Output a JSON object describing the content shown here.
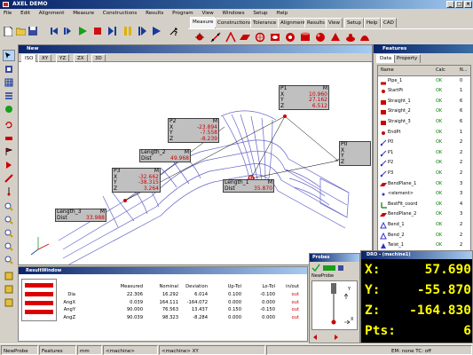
{
  "app": {
    "title": "AXEL DEMO"
  },
  "menu": [
    "File",
    "Edit",
    "Alignment",
    "Measure",
    "Constructions",
    "Results",
    "Program",
    "View",
    "Windows",
    "Setup",
    "Help"
  ],
  "ribbon_tabs": [
    "Measure",
    "Constructions",
    "Tolerance",
    "Alignment",
    "Results",
    "View",
    "Setup",
    "Help",
    "CAD"
  ],
  "ribbon_active": "Measure",
  "view_window": {
    "title": "New",
    "tabs": [
      "ISO",
      "XY",
      "YZ",
      "ZX",
      "3D"
    ],
    "active_tab": "ISO",
    "labels": [
      {
        "name": "P1",
        "flag": "M",
        "rows": [
          [
            "X",
            "10.960"
          ],
          [
            "Y",
            "27.162"
          ],
          [
            "Z",
            "6.512"
          ]
        ]
      },
      {
        "name": "P2",
        "flag": "M",
        "rows": [
          [
            "X",
            "-23.894"
          ],
          [
            "Y",
            "-7.558"
          ],
          [
            "Z",
            "-8.239"
          ]
        ]
      },
      {
        "name": "P3",
        "flag": "M",
        "rows": [
          [
            "X",
            "-32.662"
          ],
          [
            "Y",
            "-38.315"
          ],
          [
            "Z",
            "3.264"
          ]
        ]
      },
      {
        "name": "P0",
        "flag": "",
        "rows": [
          [
            "X",
            ""
          ],
          [
            "Y",
            ""
          ],
          [
            "Z",
            ""
          ]
        ]
      },
      {
        "name": "Length_2",
        "flag": "M",
        "rows": [
          [
            "Dist",
            "49.968"
          ]
        ]
      },
      {
        "name": "Length_1",
        "flag": "M",
        "rows": [
          [
            "Dist",
            "35.870"
          ]
        ]
      },
      {
        "name": "Length_3",
        "flag": "M",
        "rows": [
          [
            "Dist",
            "33.988"
          ]
        ]
      }
    ]
  },
  "features": {
    "title": "Features",
    "tabs": [
      "Data",
      "Property"
    ],
    "active_tab": "Data",
    "columns": [
      "Name",
      "Calc",
      "N..."
    ],
    "rows": [
      {
        "name": "Pipe_1",
        "calc": "OK",
        "n": "0",
        "icon": "pipe-icon",
        "color": "#cc0000"
      },
      {
        "name": "StartPt",
        "calc": "OK",
        "n": "1",
        "icon": "point-icon",
        "color": "#cc0000"
      },
      {
        "name": "Straight_1",
        "calc": "OK",
        "n": "6",
        "icon": "cylinder-icon",
        "color": "#cc0000"
      },
      {
        "name": "Straight_2",
        "calc": "OK",
        "n": "6",
        "icon": "cylinder-icon",
        "color": "#cc0000"
      },
      {
        "name": "Straight_3",
        "calc": "OK",
        "n": "6",
        "icon": "cylinder-icon",
        "color": "#cc0000"
      },
      {
        "name": "EndPt",
        "calc": "OK",
        "n": "1",
        "icon": "point-icon",
        "color": "#cc0000"
      },
      {
        "name": "P0",
        "calc": "OK",
        "n": "2",
        "icon": "point-vector-icon",
        "color": "#3333cc"
      },
      {
        "name": "P1",
        "calc": "OK",
        "n": "2",
        "icon": "point-vector-icon",
        "color": "#3333cc"
      },
      {
        "name": "P2",
        "calc": "OK",
        "n": "2",
        "icon": "point-vector-icon",
        "color": "#3333cc"
      },
      {
        "name": "P3",
        "calc": "OK",
        "n": "2",
        "icon": "point-vector-icon",
        "color": "#3333cc"
      },
      {
        "name": "BendPlane_1",
        "calc": "OK",
        "n": "3",
        "icon": "plane-icon",
        "color": "#cc0000"
      },
      {
        "name": "<element>",
        "calc": "OK",
        "n": "3",
        "icon": "element-icon",
        "color": "#3333cc"
      },
      {
        "name": "BestFit_coord",
        "calc": "OK",
        "n": "4",
        "icon": "coord-icon",
        "color": "#008000"
      },
      {
        "name": "BendPlane_2",
        "calc": "OK",
        "n": "3",
        "icon": "plane-icon",
        "color": "#cc0000"
      },
      {
        "name": "Bend_1",
        "calc": "OK",
        "n": "2",
        "icon": "bend-icon",
        "color": "#3333cc"
      },
      {
        "name": "Bend_2",
        "calc": "OK",
        "n": "2",
        "icon": "bend-icon",
        "color": "#3333cc"
      },
      {
        "name": "Twist_1",
        "calc": "OK",
        "n": "2",
        "icon": "twist-icon",
        "color": "#3333cc"
      }
    ]
  },
  "result_window": {
    "title": "ResultWindow",
    "columns": [
      "",
      "Measured",
      "Nominal",
      "Deviation",
      "Up-Tol",
      "Lo-Tol",
      "in/out"
    ],
    "rows": [
      [
        "Dia",
        "22.306",
        "16.292",
        "6.014",
        "0.100",
        "-0.100",
        "out"
      ],
      [
        "AngX",
        "0.039",
        "164.111",
        "-164.072",
        "0.000",
        "0.000",
        "out"
      ],
      [
        "AngY",
        "90.000",
        "76.563",
        "13.437",
        "0.150",
        "-0.150",
        "out"
      ],
      [
        "AngZ",
        "90.039",
        "98.323",
        "-8.284",
        "0.000",
        "0.000",
        "out"
      ]
    ]
  },
  "probes": {
    "title": "Probes",
    "selected": "NewProbe",
    "axis_labels": {
      "y": "Y",
      "x": "X"
    }
  },
  "dro": {
    "title": "DRO - (machine1)",
    "lines": [
      {
        "label": "X:",
        "value": "57.690"
      },
      {
        "label": "Y:",
        "value": "-55.870"
      },
      {
        "label": "Z:",
        "value": "-164.830"
      },
      {
        "label": "Pts:",
        "value": "6"
      }
    ]
  },
  "status": [
    "NewProbe",
    "Features",
    "mm",
    "<machine>",
    "<machine> XY",
    "EM: none  TC: off"
  ],
  "colors": {
    "title_bar": "#0a246a",
    "dro_text": "#ffff00",
    "error_red": "#cc0000",
    "wireframe_blue": "#6464c8"
  }
}
